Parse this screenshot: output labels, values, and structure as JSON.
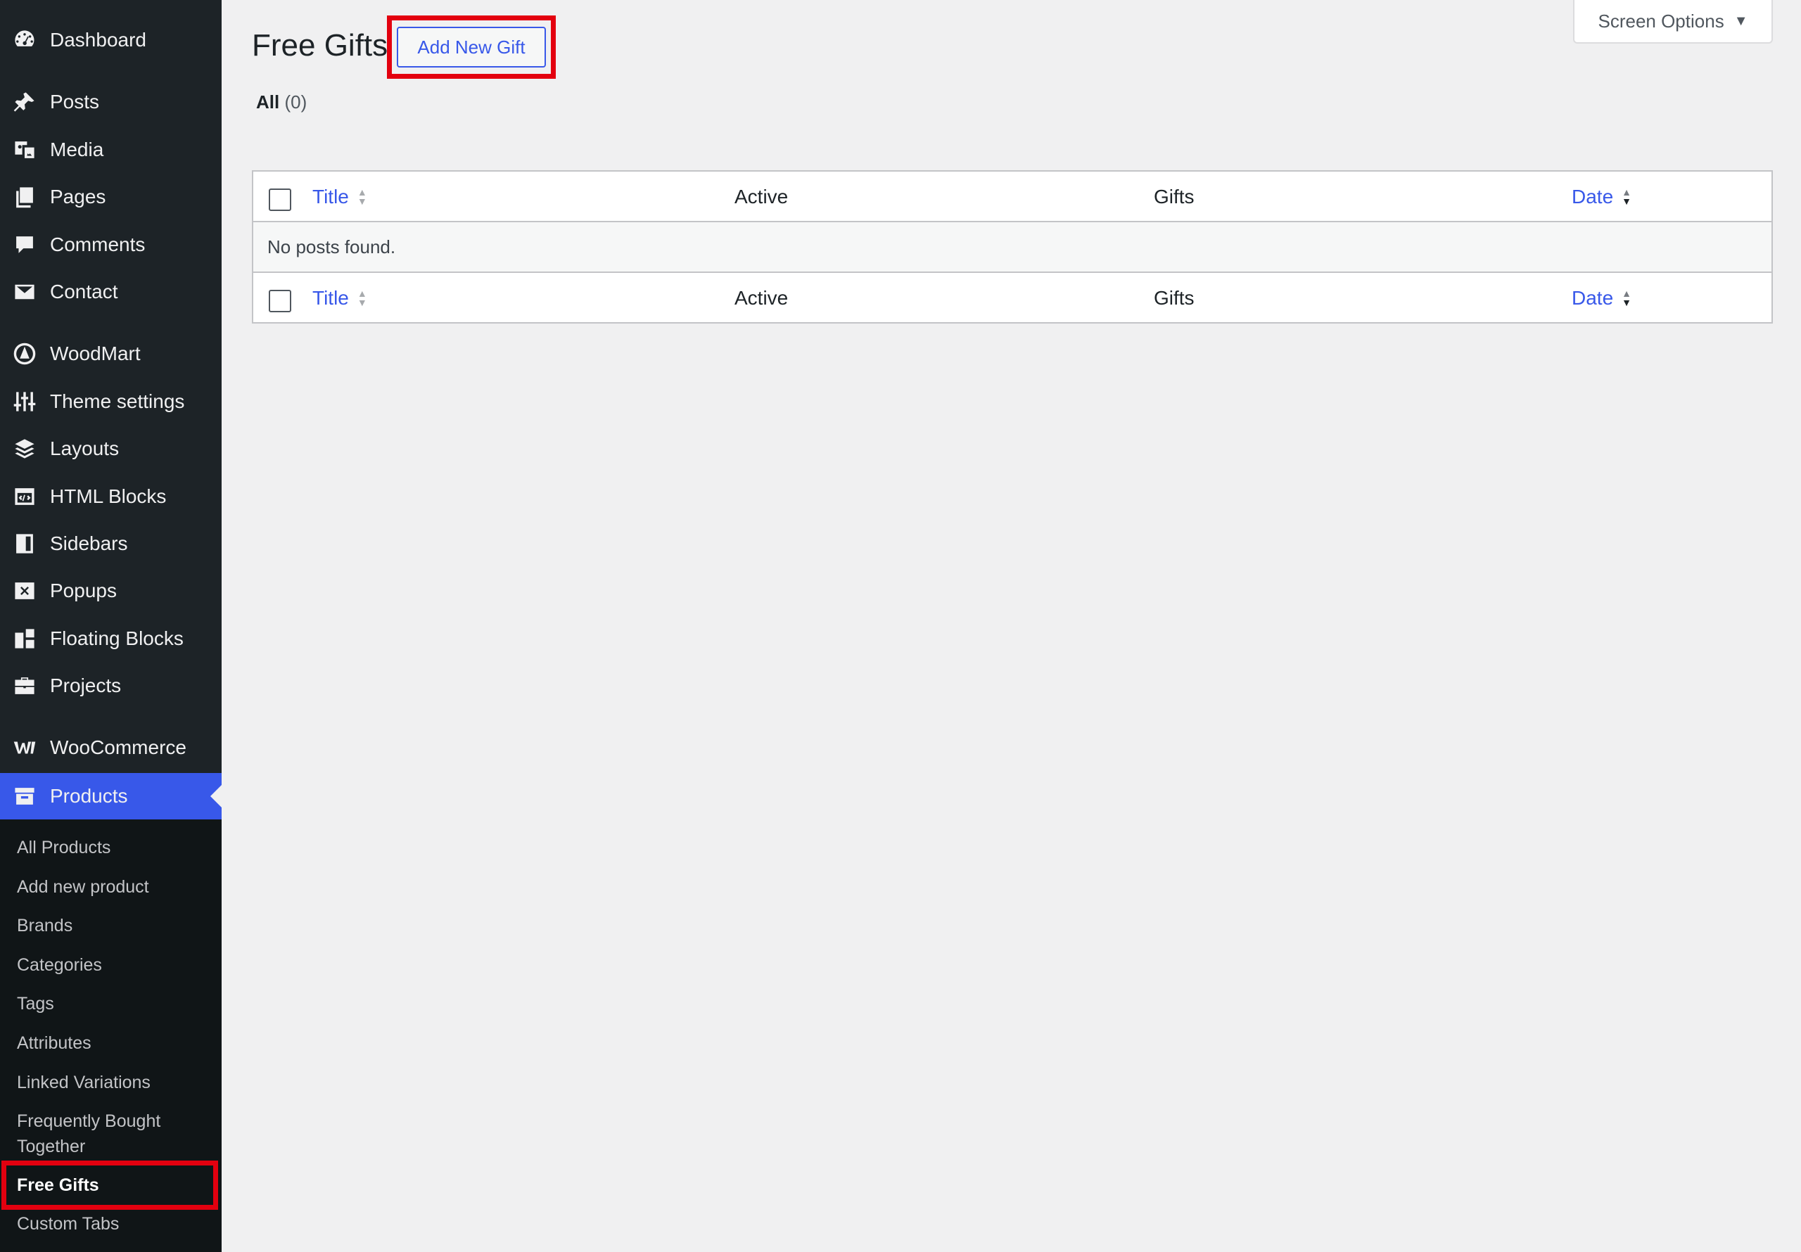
{
  "sidebar": {
    "items": [
      {
        "label": "Dashboard",
        "icon": "dashboard-icon"
      },
      {
        "label": "Posts",
        "icon": "pin-icon"
      },
      {
        "label": "Media",
        "icon": "media-icon"
      },
      {
        "label": "Pages",
        "icon": "pages-icon"
      },
      {
        "label": "Comments",
        "icon": "comment-icon"
      },
      {
        "label": "Contact",
        "icon": "envelope-icon"
      },
      {
        "label": "WoodMart",
        "icon": "woodmart-icon"
      },
      {
        "label": "Theme settings",
        "icon": "sliders-icon"
      },
      {
        "label": "Layouts",
        "icon": "layers-icon"
      },
      {
        "label": "HTML Blocks",
        "icon": "code-block-icon"
      },
      {
        "label": "Sidebars",
        "icon": "sidebar-icon"
      },
      {
        "label": "Popups",
        "icon": "popup-icon"
      },
      {
        "label": "Floating Blocks",
        "icon": "floating-blocks-icon"
      },
      {
        "label": "Projects",
        "icon": "briefcase-icon"
      },
      {
        "label": "WooCommerce",
        "icon": "woocommerce-icon"
      },
      {
        "label": "Products",
        "icon": "archive-box-icon",
        "current": true
      }
    ],
    "submenu": [
      {
        "label": "All Products"
      },
      {
        "label": "Add new product"
      },
      {
        "label": "Brands"
      },
      {
        "label": "Categories"
      },
      {
        "label": "Tags"
      },
      {
        "label": "Attributes"
      },
      {
        "label": "Linked Variations"
      },
      {
        "label": "Frequently Bought Together"
      },
      {
        "label": "Free Gifts",
        "current": true
      },
      {
        "label": "Custom Tabs"
      }
    ]
  },
  "header": {
    "title": "Free Gifts",
    "add_new_label": "Add New Gift",
    "screen_options_label": "Screen Options"
  },
  "filters": {
    "all_label": "All",
    "all_count": "(0)"
  },
  "table": {
    "columns": [
      "Title",
      "Active",
      "Gifts",
      "Date"
    ],
    "empty_message": "No posts found."
  },
  "colors": {
    "sidebar_bg": "#1d2327",
    "submenu_bg": "#101517",
    "accent": "#3858e9",
    "highlight_box": "#e3000f"
  }
}
